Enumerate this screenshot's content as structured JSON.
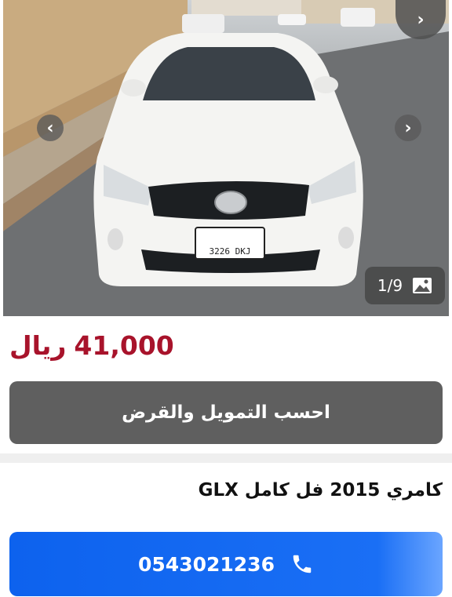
{
  "gallery": {
    "counter": "1/9",
    "plate_text": "3226 DKJ"
  },
  "listing": {
    "price": "41,000",
    "currency": "ريال",
    "finance_label": "احسب التمويل والقرض",
    "title": "كامري 2015 فل كامل GLX",
    "phone": "0543021236"
  },
  "icons": {
    "next": "chevron-right-icon",
    "prev": "chevron-left-icon",
    "image": "image-icon",
    "phone": "phone-icon"
  },
  "colors": {
    "price": "#a8132b",
    "finance_button": "#5f5f5f",
    "call_button": "#0d62ee"
  }
}
